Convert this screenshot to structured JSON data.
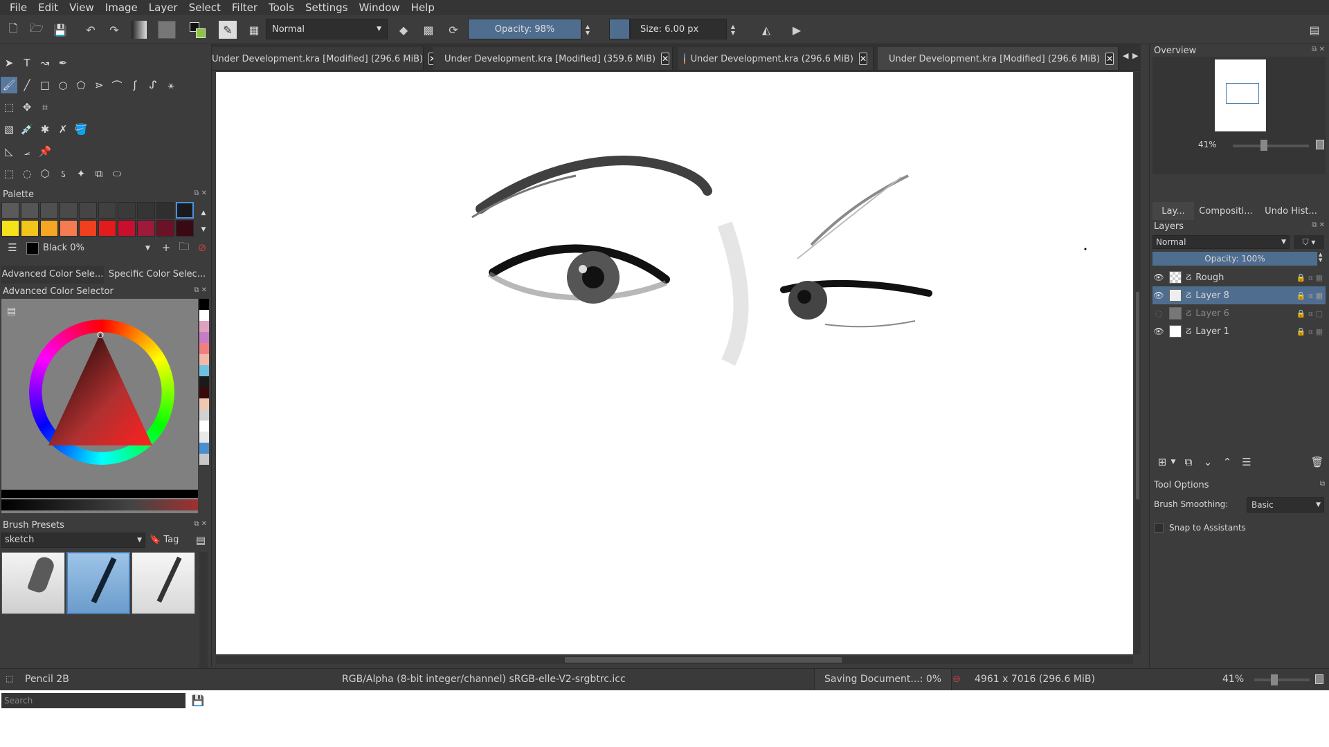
{
  "menu": [
    "File",
    "Edit",
    "View",
    "Image",
    "Layer",
    "Select",
    "Filter",
    "Tools",
    "Settings",
    "Window",
    "Help"
  ],
  "toolbar": {
    "blend_mode": "Normal",
    "opacity": "Opacity:  98%",
    "size": "Size:  6.00 px"
  },
  "tabs": [
    {
      "label": "Under Development.kra [Modified]  (296.6 MiB)"
    },
    {
      "label": "Under Development.kra [Modified]  (359.6 MiB)"
    },
    {
      "label": "Under Development.kra  (296.6 MiB)"
    },
    {
      "label": "Under Development.kra [Modified]  (296.6 MiB)"
    }
  ],
  "palette": {
    "title": "Palette",
    "current_color": "Black 0%",
    "grays": [
      "#5a5a5a",
      "#555555",
      "#505050",
      "#4a4a4a",
      "#454545",
      "#404040",
      "#3a3a3a",
      "#353535",
      "#2f2f2f",
      "#1a1a1a"
    ],
    "colors": [
      "#f6e21a",
      "#f3c51a",
      "#f5a623",
      "#f57c51",
      "#f0401e",
      "#e21c1c",
      "#c8102e",
      "#9e1a3a",
      "#6b1228",
      "#3a0a14"
    ]
  },
  "color_selector": {
    "tabs": [
      "Advanced Color Sele...",
      "Specific Color Selec..."
    ],
    "title": "Advanced Color Selector",
    "history": [
      "#000000",
      "#ffffff",
      "#e0a0c0",
      "#c87cc8",
      "#f08080",
      "#f4b8a8",
      "#70c0e0",
      "#1a1a1a",
      "#3a0a0a",
      "#f0c8b0",
      "#d0d0d0",
      "#ffffff",
      "#e8e8e8",
      "#4a90d0",
      "#c8c8c8"
    ]
  },
  "brush_presets": {
    "title": "Brush Presets",
    "tag": "sketch",
    "tag_button": "Tag",
    "search_placeholder": "Search"
  },
  "overview": {
    "title": "Overview",
    "zoom": "41%"
  },
  "right_tabs": [
    "Lay...",
    "Compositi...",
    "Undo Hist..."
  ],
  "layers": {
    "title": "Layers",
    "blend": "Normal",
    "opacity": "Opacity:  100%",
    "items": [
      {
        "name": "Rough",
        "visible": true
      },
      {
        "name": "Layer 8",
        "visible": true,
        "selected": true
      },
      {
        "name": "Layer 6",
        "visible": false
      },
      {
        "name": "Layer 1",
        "visible": true
      }
    ]
  },
  "tool_options": {
    "title": "Tool Options",
    "smoothing_label": "Brush Smoothing:",
    "smoothing_value": "Basic",
    "snap_label": "Snap to Assistants"
  },
  "status": {
    "brush": "Pencil 2B",
    "color_model": "RGB/Alpha (8-bit integer/channel)  sRGB-elle-V2-srgbtrc.icc",
    "saving": "Saving Document...: 0%",
    "dimensions": "4961 x 7016 (296.6 MiB)",
    "zoom": "41%"
  }
}
